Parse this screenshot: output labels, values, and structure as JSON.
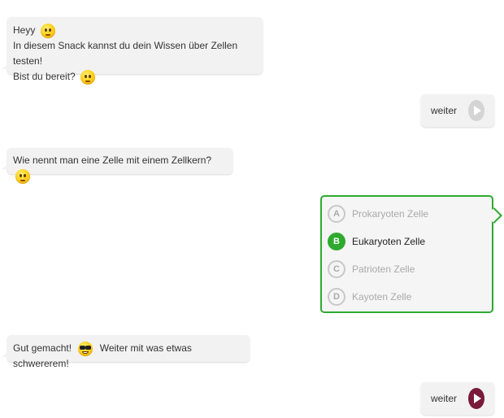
{
  "messages": {
    "greeting": {
      "line1": "Heyy",
      "line2": "In diesem Snack kannst du dein Wissen über Zellen testen!",
      "line3": "Bist du bereit?"
    },
    "question": "Wie nennt man eine Zelle mit einem Zellkern?",
    "feedback": {
      "part1": "Gut gemacht!",
      "part2": "Weiter mit was etwas schwererem!"
    }
  },
  "buttons": {
    "weiter_first": {
      "label": "weiter",
      "state": "answered"
    },
    "weiter_second": {
      "label": "weiter",
      "state": "active"
    }
  },
  "quiz": {
    "selected": "B",
    "options": [
      {
        "letter": "A",
        "text": "Prokaryoten Zelle"
      },
      {
        "letter": "B",
        "text": "Eukaryoten Zelle"
      },
      {
        "letter": "C",
        "text": "Patrioten Zelle"
      },
      {
        "letter": "D",
        "text": "Kayoten Zelle"
      }
    ]
  },
  "icons": {
    "emoji_thinking": "thinking-face-icon",
    "emoji_cool": "sunglasses-face-icon",
    "play_icon": "play-icon"
  },
  "colors": {
    "correct_green": "#2eaa2e",
    "active_play": "#7a1a3a",
    "inactive_play": "#d4d4d4",
    "bubble_bg": "#f2f2f2"
  }
}
